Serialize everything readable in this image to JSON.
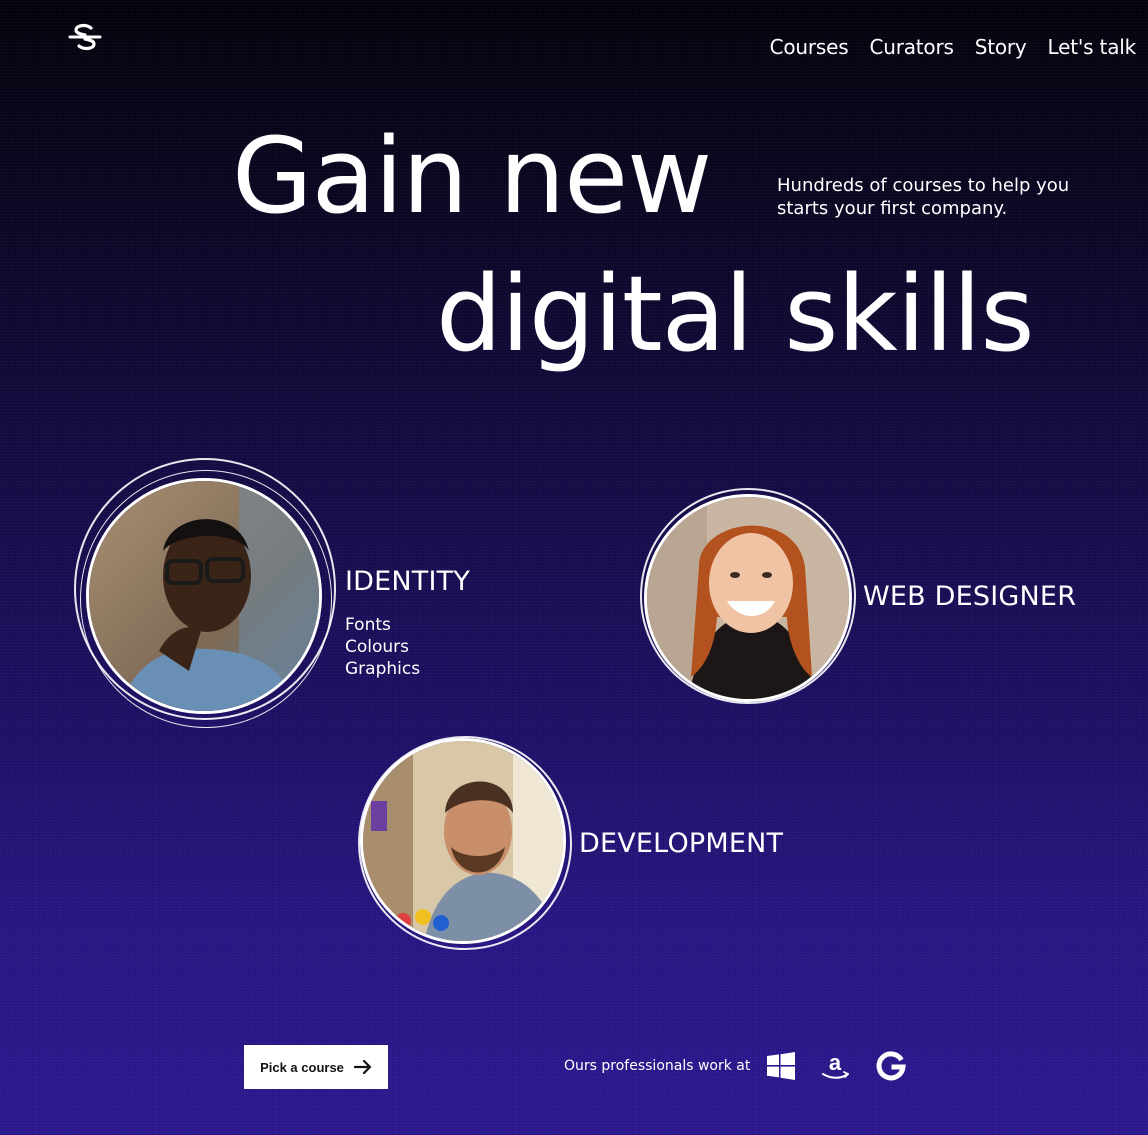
{
  "nav": {
    "logo_icon": "s-swoosh-logo-icon",
    "items": [
      {
        "label": "Courses"
      },
      {
        "label": "Curators"
      },
      {
        "label": "Story"
      },
      {
        "label": "Let's talk"
      }
    ]
  },
  "hero": {
    "line1": "Gain new",
    "line2": "digital skills",
    "tagline": "Hundreds of courses to help you starts your first company."
  },
  "categories": {
    "identity": {
      "title": "IDENTITY",
      "items": [
        "Fonts",
        "Colours",
        "Graphics"
      ]
    },
    "web": {
      "title": "WEB DESIGNER"
    },
    "dev": {
      "title": "DEVELOPMENT"
    }
  },
  "footer": {
    "cta_label": "Pick a course",
    "cta_icon": "arrow-right-icon",
    "pros_text": "Ours professionals work at",
    "brands": [
      "windows-logo-icon",
      "amazon-logo-icon",
      "google-logo-icon"
    ]
  },
  "colors": {
    "bg_top": "#02020c",
    "bg_bottom": "#2b1890",
    "text": "#ffffff",
    "button_bg": "#ffffff"
  }
}
